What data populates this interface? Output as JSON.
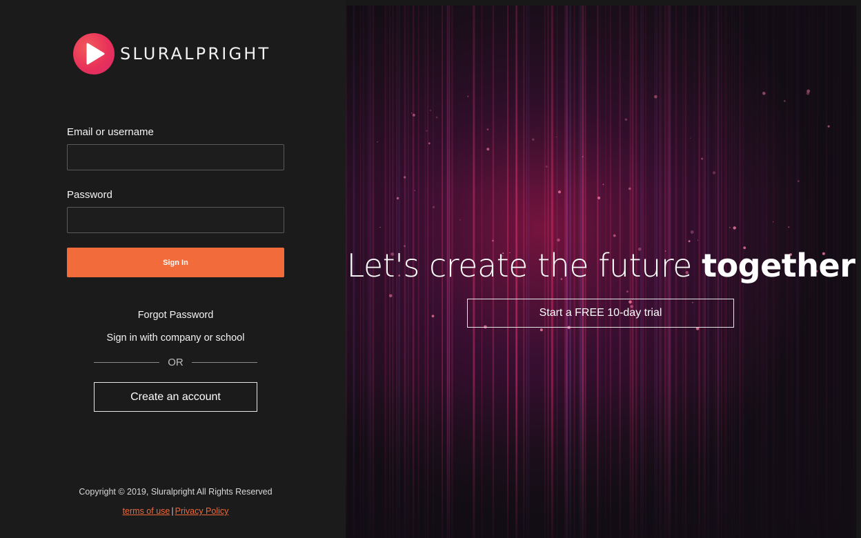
{
  "brand": {
    "name": "SLURALPRIGHT",
    "accent": "#f26b3a",
    "logo_color": "#e8315a"
  },
  "form": {
    "email_label": "Email or username",
    "email_value": "",
    "password_label": "Password",
    "password_value": "",
    "signin_label": "Sign In"
  },
  "links": {
    "forgot_password": "Forgot Password",
    "sso": "Sign in with company or school",
    "or": "OR",
    "create_account": "Create an account"
  },
  "footer": {
    "copyright": "Copyright © 2019, Sluralpright All Rights Reserved",
    "terms": "terms of use",
    "separator": "|",
    "privacy": "Privacy Policy"
  },
  "hero": {
    "headline_light": "Let's create the future",
    "headline_bold": "together",
    "trial_label": "Start a FREE 10-day trial"
  }
}
